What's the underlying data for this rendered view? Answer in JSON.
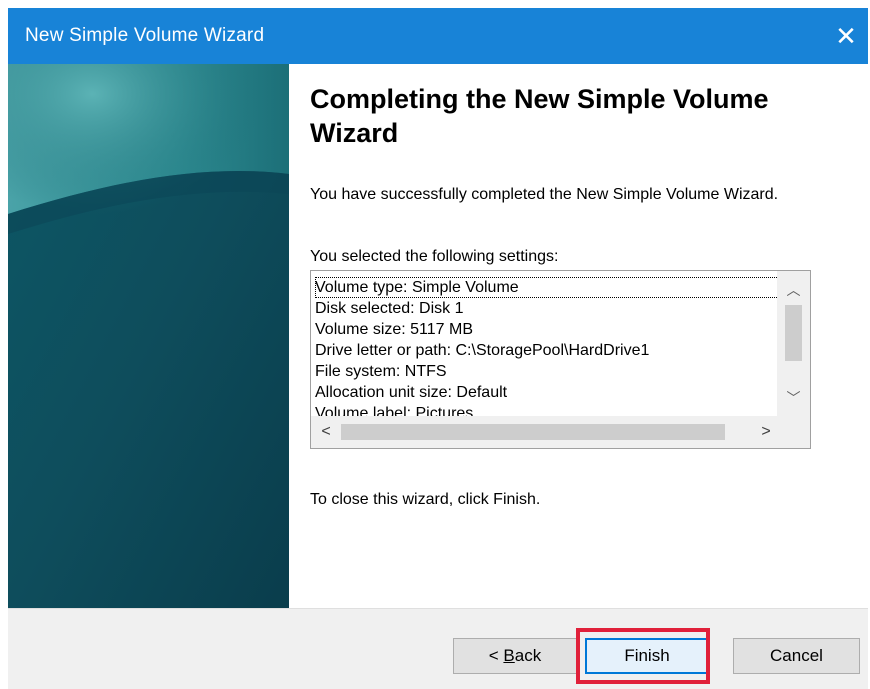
{
  "window": {
    "title": "New Simple Volume Wizard",
    "close_glyph": "✕"
  },
  "content": {
    "heading": "Completing the New Simple Volume Wizard",
    "success_text": "You have successfully completed the New Simple Volume Wizard.",
    "settings_label": "You selected the following settings:",
    "settings": [
      "Volume type: Simple Volume",
      "Disk selected: Disk 1",
      "Volume size: 5117 MB",
      "Drive letter or path: C:\\StoragePool\\HardDrive1",
      "File system: NTFS",
      "Allocation unit size: Default",
      "Volume label: Pictures"
    ],
    "close_instruction": "To close this wizard, click Finish."
  },
  "scrollbars": {
    "up_glyph": "︿",
    "down_glyph": "﹀",
    "left_glyph": "<",
    "right_glyph": ">"
  },
  "buttons": {
    "back_prefix": "< ",
    "back_accel": "B",
    "back_rest": "ack",
    "finish": "Finish",
    "cancel": "Cancel"
  },
  "colors": {
    "titlebar": "#1883d7",
    "side_panel_dark": "#0f4f5e",
    "side_panel_light": "#2e8a8e",
    "highlight": "#e0203a"
  },
  "icons": {
    "close": "close-icon",
    "scroll_up": "chevron-up-icon",
    "scroll_down": "chevron-down-icon",
    "scroll_left": "chevron-left-icon",
    "scroll_right": "chevron-right-icon"
  }
}
